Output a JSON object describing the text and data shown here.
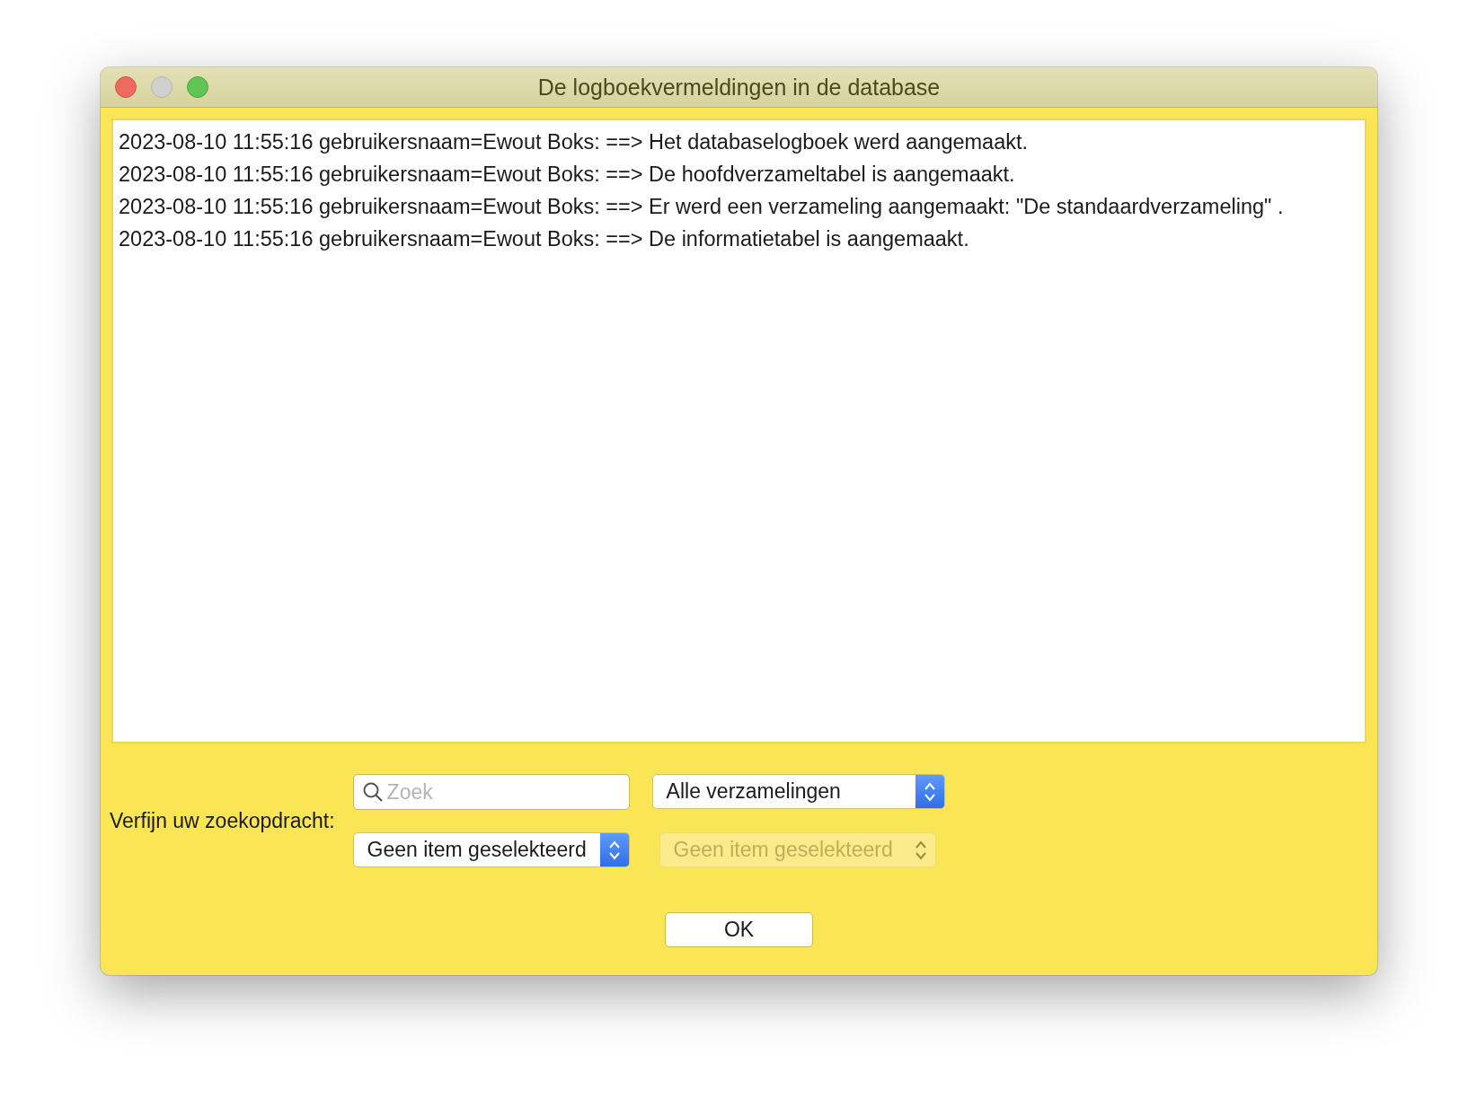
{
  "window": {
    "title": "De logboekvermeldingen in de database"
  },
  "log_entries": [
    "2023-08-10 11:55:16 gebruikersnaam=Ewout Boks: ==> Het databaselogboek werd aangemaakt.",
    "2023-08-10 11:55:16 gebruikersnaam=Ewout Boks: ==> De hoofdverzameltabel is aangemaakt.",
    "2023-08-10 11:55:16 gebruikersnaam=Ewout Boks: ==> Er werd een verzameling aangemaakt: \"De standaardverzameling\" .",
    "2023-08-10 11:55:16 gebruikersnaam=Ewout Boks: ==> De informatietabel is aangemaakt."
  ],
  "filter": {
    "label": "Verfijn uw zoekopdracht:",
    "search": {
      "placeholder": "Zoek"
    },
    "dropdowns": [
      {
        "value": "Alle verzamelingen",
        "disabled": false
      },
      {
        "value": "Geen item geselekteerd",
        "disabled": false
      },
      {
        "value": "Geen item geselekteerd",
        "disabled": true
      }
    ]
  },
  "buttons": [
    "OK"
  ]
}
